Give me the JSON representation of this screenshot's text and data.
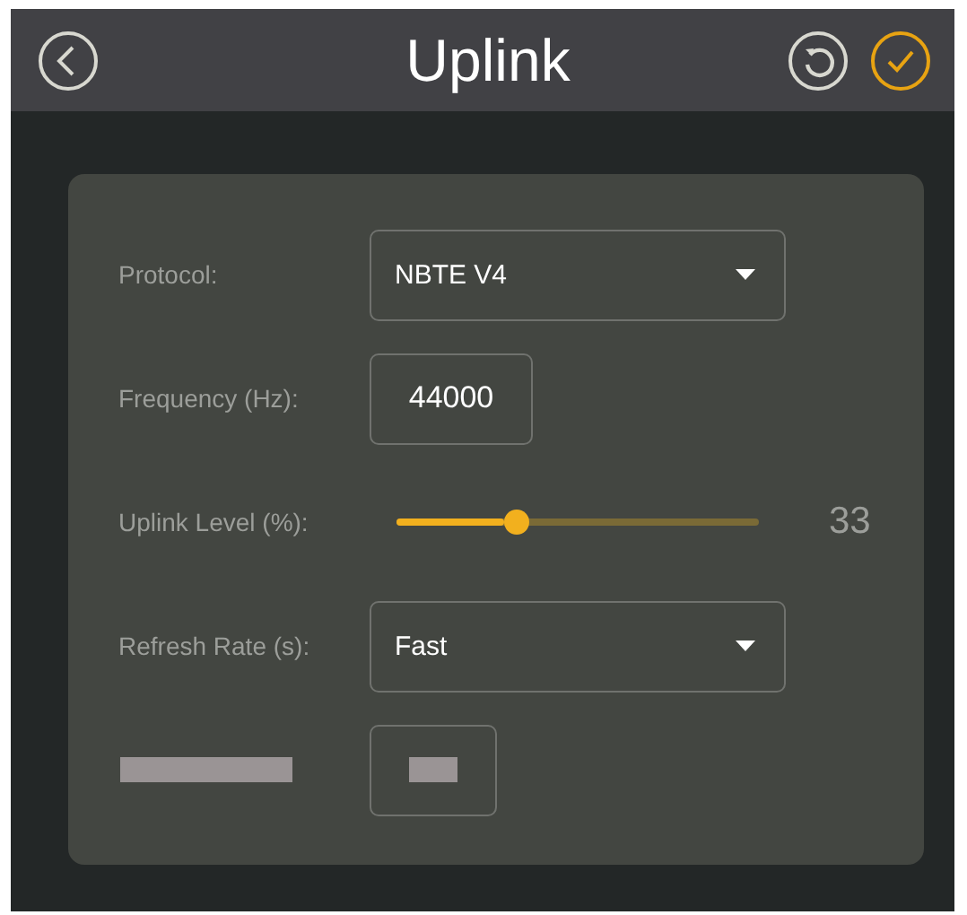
{
  "header": {
    "title": "Uplink"
  },
  "rows": [
    {
      "kind": "select",
      "label": "Protocol:",
      "value": "NBTE V4"
    },
    {
      "kind": "input",
      "label": "Frequency (Hz):",
      "value": "44000"
    },
    {
      "kind": "slider",
      "label": "Uplink Level (%):",
      "level": 0.33,
      "reading": "33"
    },
    {
      "kind": "select",
      "label": "Refresh Rate (s):",
      "value": "Fast"
    },
    {
      "kind": "placeholder"
    }
  ]
}
